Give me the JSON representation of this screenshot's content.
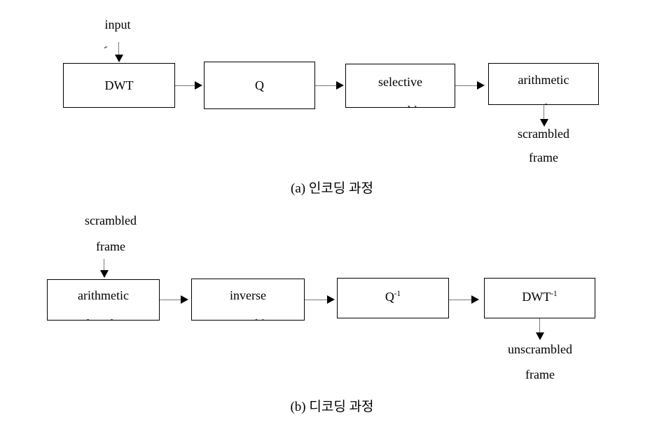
{
  "figure": {
    "background_color": "#ffffff",
    "stroke_color": "#000000",
    "connector_color": "#7a7a7a"
  },
  "encoding": {
    "caption": "(a) 인코딩 과정",
    "input_label_line1": "input",
    "input_label_line2": "frame",
    "output_label_line1": "scrambled",
    "output_label_line2": "frame",
    "blocks": [
      {
        "line1": "DWT",
        "line2": ""
      },
      {
        "line1": "Q",
        "line2": ""
      },
      {
        "line1": "selective",
        "line2": "scramble"
      },
      {
        "line1": "arithmetic",
        "line2": "coder"
      }
    ]
  },
  "decoding": {
    "caption": "(b) 디코딩 과정",
    "input_label_line1": "scrambled",
    "input_label_line2": "frame",
    "output_label_line1": "unscrambled",
    "output_label_line2": "frame",
    "blocks": [
      {
        "line1": "arithmetic",
        "line2": "decoder"
      },
      {
        "line1": "inverse",
        "line2": "scramble"
      },
      {
        "line1": "Q",
        "line2": "",
        "superscript": "-1"
      },
      {
        "line1": "DWT",
        "line2": "",
        "superscript": "-1"
      }
    ]
  }
}
